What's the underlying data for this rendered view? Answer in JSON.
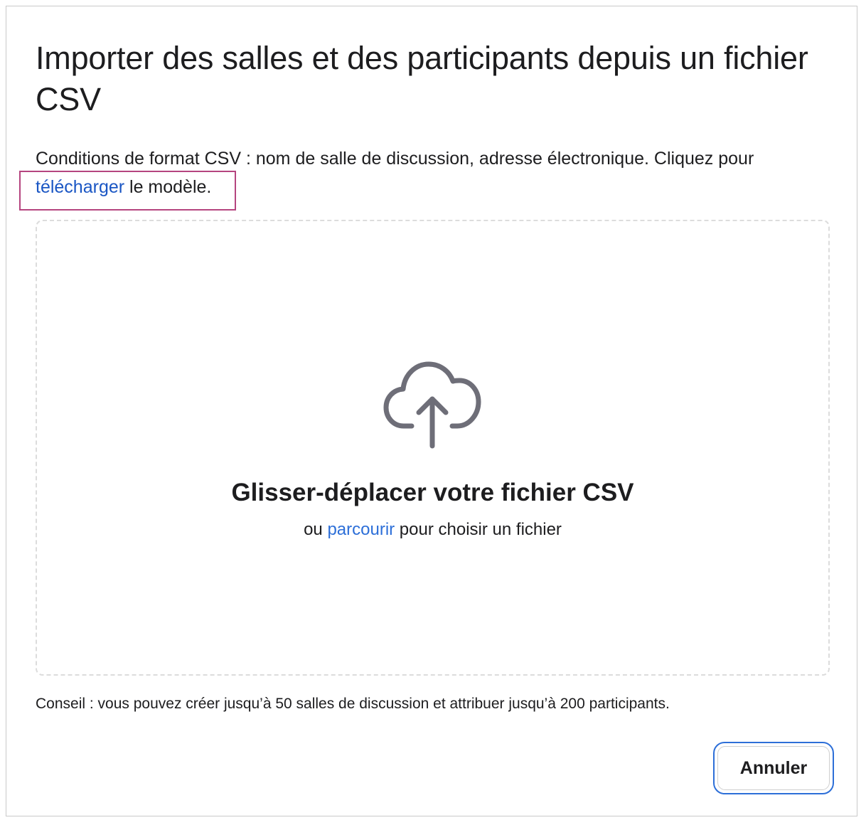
{
  "dialog": {
    "title": "Importer des salles et des participants depuis un fichier CSV",
    "requirements": {
      "text_before": "Conditions de format CSV : nom de salle de discussion, adresse électronique. Cliquez pour ",
      "link_label": "télécharger",
      "text_after": " le modèle."
    },
    "dropzone": {
      "icon": "cloud-upload-icon",
      "title": "Glisser-déplacer votre fichier CSV",
      "sub_before": "ou ",
      "browse_label": "parcourir",
      "sub_after": " pour choisir un fichier"
    },
    "tip": "Conseil : vous pouvez créer jusqu’à 50 salles de discussion et attribuer jusqu’à 200 participants.",
    "cancel_label": "Annuler"
  },
  "colors": {
    "link": "#1a56c4",
    "accent": "#2d6fd8",
    "highlight": "#b5457f",
    "icon": "#6e6e78"
  }
}
